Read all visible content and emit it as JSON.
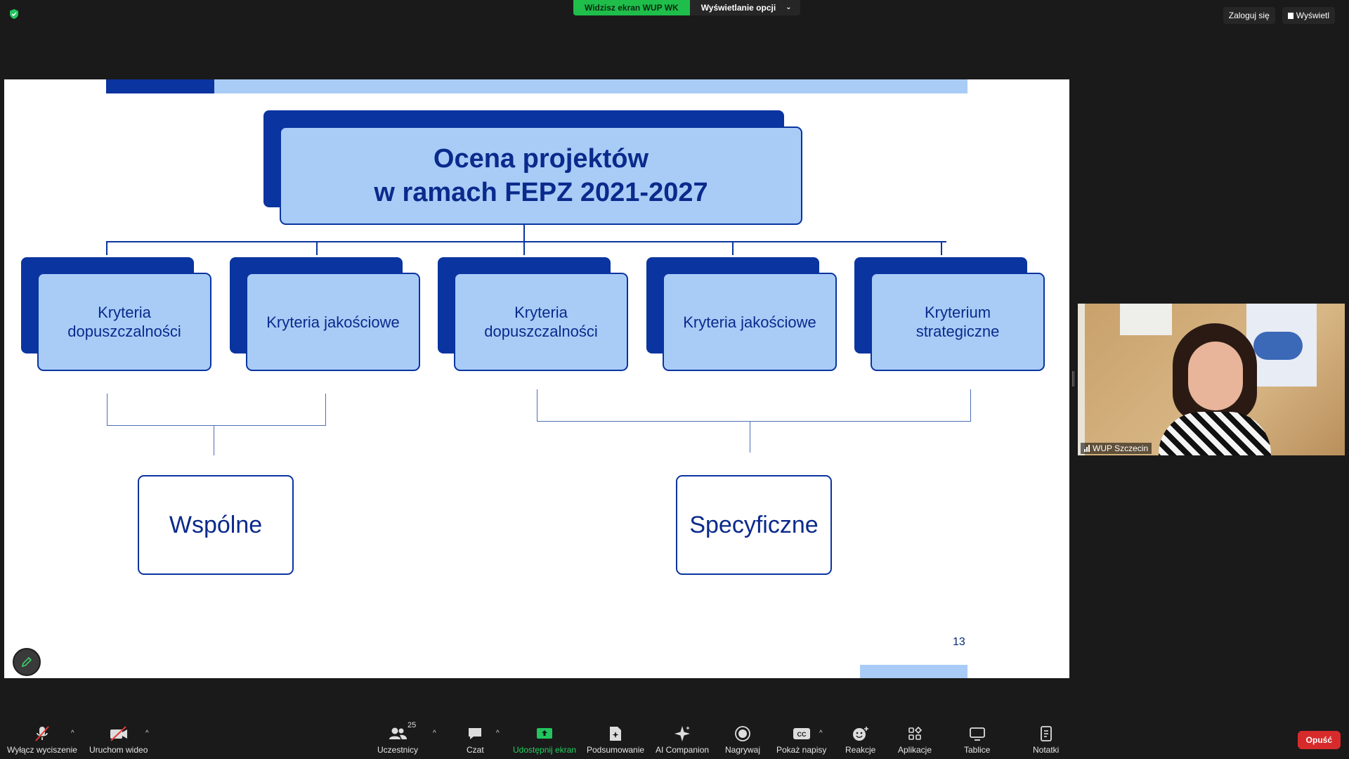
{
  "top_bar": {
    "share_status": "Widzisz ekran WUP WK",
    "view_options": "Wyświetlanie opcji",
    "sign_in": "Zaloguj się",
    "view": "Wyświetl"
  },
  "slide": {
    "title_line1": "Ocena projektów",
    "title_line2": "w ramach FEPZ 2021-2027",
    "criteria": [
      {
        "line1": "Kryteria",
        "line2": "dopuszczalności"
      },
      {
        "line1": "Kryteria jakościowe",
        "line2": ""
      },
      {
        "line1": "Kryteria",
        "line2": "dopuszczalności"
      },
      {
        "line1": "Kryteria jakościowe",
        "line2": ""
      },
      {
        "line1": "Kryterium",
        "line2": "strategiczne"
      }
    ],
    "common": "Wspólne",
    "specific": "Specyficzne",
    "page_number": "13",
    "colors": {
      "dark_blue": "#0a34a0",
      "light_blue": "#a9ccf7"
    }
  },
  "participant": {
    "name": "WUP Szczecin"
  },
  "toolbar": {
    "mute": "Wyłącz wyciszenie",
    "video": "Uruchom wideo",
    "participants": "Uczestnicy",
    "participants_count": "25",
    "chat": "Czat",
    "share": "Udostępnij ekran",
    "summary": "Podsumowanie",
    "ai": "AI Companion",
    "record": "Nagrywaj",
    "captions": "Pokaż napisy",
    "reactions": "Reakcje",
    "apps": "Aplikacje",
    "whiteboards": "Tablice",
    "notes": "Notatki",
    "leave": "Opuść"
  }
}
